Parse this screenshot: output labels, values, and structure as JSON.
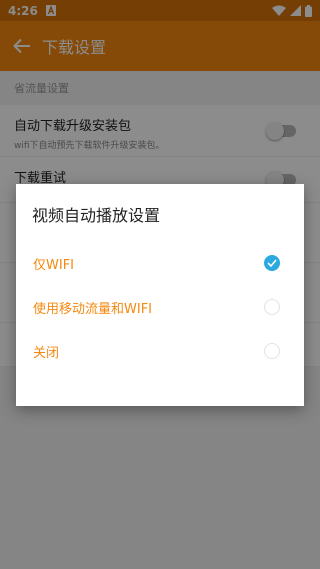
{
  "status_bar": {
    "time": "4:26"
  },
  "app_bar": {
    "title": "下载设置"
  },
  "settings": {
    "section_header": "省流量设置",
    "auto_download": {
      "title": "自动下载升级安装包",
      "subtitle": "wifi下自动预先下载软件升级安装包。"
    },
    "download_retry": {
      "title": "下载重试"
    }
  },
  "dialog": {
    "title": "视频自动播放设置",
    "options": [
      {
        "label": "仅WIFI",
        "selected": true
      },
      {
        "label": "使用移动流量和WIFI",
        "selected": false
      },
      {
        "label": "关闭",
        "selected": false
      }
    ]
  },
  "colors": {
    "accent": "#f5880f",
    "status_bar": "#d4720a",
    "check": "#2aa9e0"
  }
}
